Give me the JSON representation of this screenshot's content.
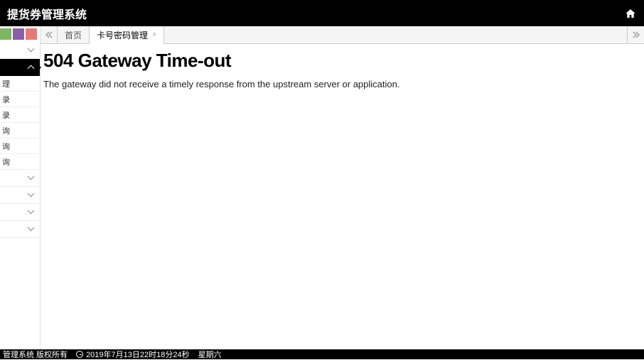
{
  "header": {
    "title": "提货券管理系统"
  },
  "sidebar": {
    "subitems": [
      "理",
      "录",
      "录",
      "询",
      "询",
      "询"
    ]
  },
  "tabs": {
    "home": "首页",
    "active": "卡号密码管理"
  },
  "error": {
    "title": "504 Gateway Time-out",
    "message": "The gateway did not receive a timely response from the upstream server or application."
  },
  "footer": {
    "copyright": "管理系统 版权所有",
    "datetime": "2019年7月13日22时18分24秒",
    "weekday": "星期六"
  }
}
